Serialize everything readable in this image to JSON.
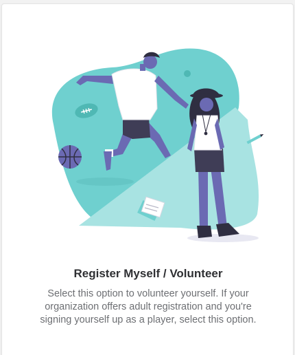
{
  "option_card": {
    "title": "Register Myself / Volunteer",
    "description": "Select this option to volunteer yourself. If your organization offers adult registration and you're signing yourself up as a player, select this option.",
    "illustration_icon": "athlete-and-volunteer-illustration"
  },
  "colors": {
    "accent_teal": "#6fd0cf",
    "light_teal": "#a8e3e2",
    "figure_purple": "#6b6ab3",
    "dark_navy": "#2f2e41"
  }
}
